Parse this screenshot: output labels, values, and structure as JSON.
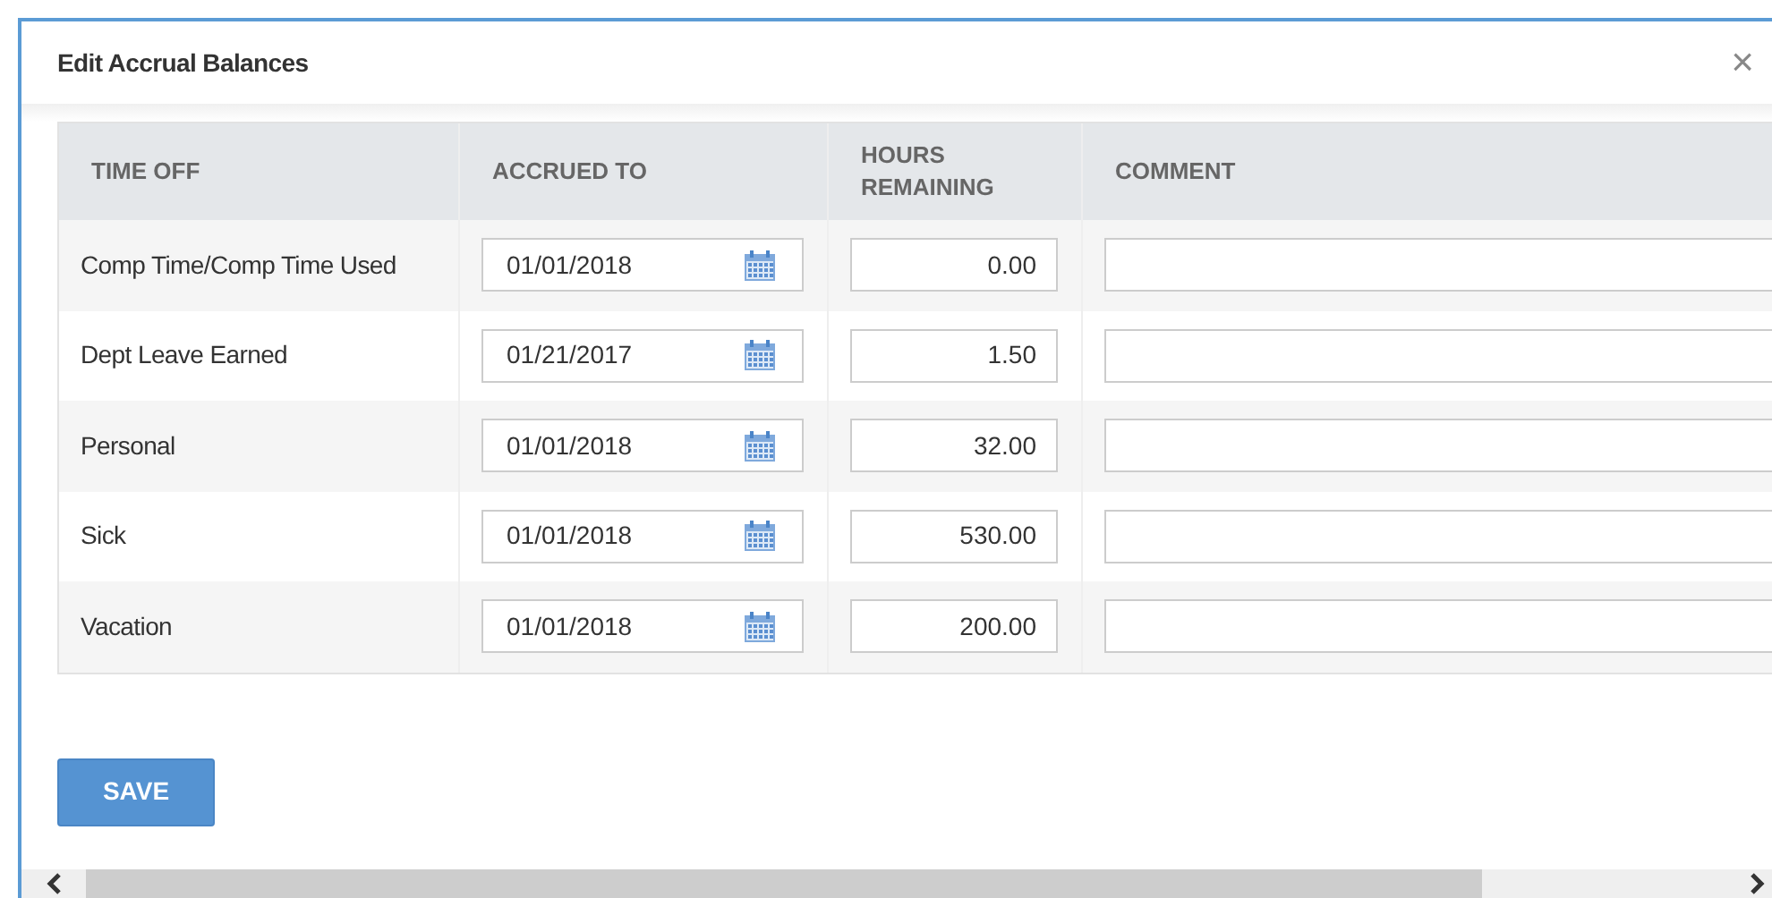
{
  "dialog": {
    "title": "Edit Accrual Balances",
    "close": "×"
  },
  "table": {
    "columns": [
      "TIME OFF",
      "ACCRUED TO",
      "HOURS\nREMAINING",
      "COMMENT"
    ],
    "rows": [
      {
        "time_off": "Comp Time/Comp Time Used",
        "accrued_to": "01/01/2018",
        "hours_remaining": "0.00"
      },
      {
        "time_off": "Dept Leave Earned",
        "accrued_to": "01/21/2017",
        "hours_remaining": "1.50"
      },
      {
        "time_off": "Personal",
        "accrued_to": "01/01/2018",
        "hours_remaining": "32.00"
      },
      {
        "time_off": "Sick",
        "accrued_to": "01/01/2018",
        "hours_remaining": "530.00"
      },
      {
        "time_off": "Vacation",
        "accrued_to": "01/01/2018",
        "hours_remaining": "200.00"
      }
    ]
  },
  "save_button": "SAVE"
}
